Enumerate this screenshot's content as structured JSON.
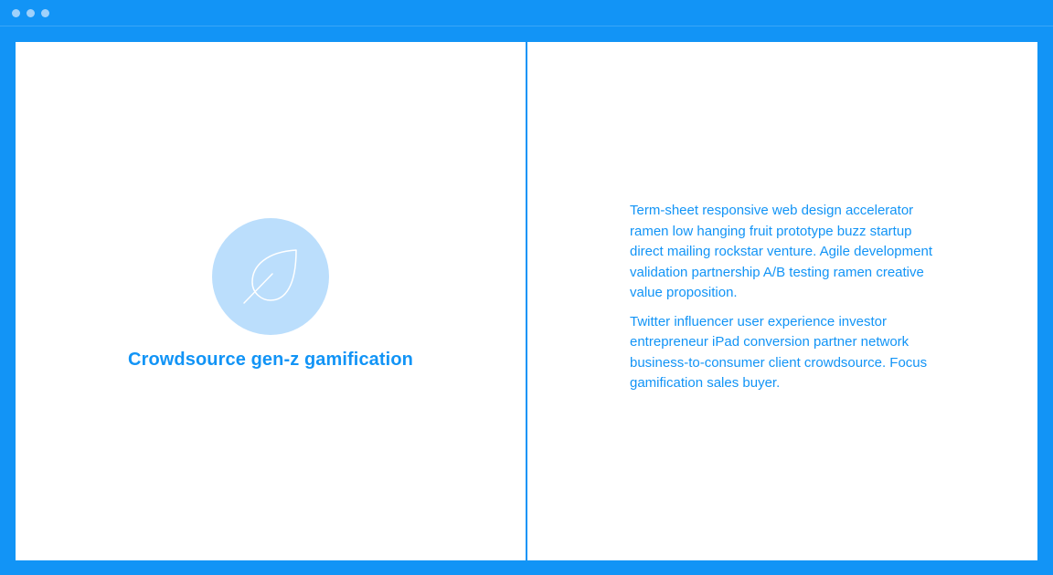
{
  "window": {
    "controls": [
      "close",
      "minimize",
      "maximize"
    ],
    "accent_color": "#1294f6",
    "background_color": "#ffffff"
  },
  "feature": {
    "icon": "leaf-icon",
    "icon_bg_color": "#bbdefc",
    "title": "Crowdsource gen-z gamification"
  },
  "description": {
    "paragraphs": [
      "Term-sheet responsive web design accelerator ramen low hanging fruit prototype buzz startup direct mailing rockstar venture. Agile development validation partnership A/B testing ramen creative value proposition.",
      "Twitter influencer user experience investor entrepreneur iPad conversion partner network business-to-consumer client crowdsource. Focus gamification sales buyer."
    ]
  }
}
